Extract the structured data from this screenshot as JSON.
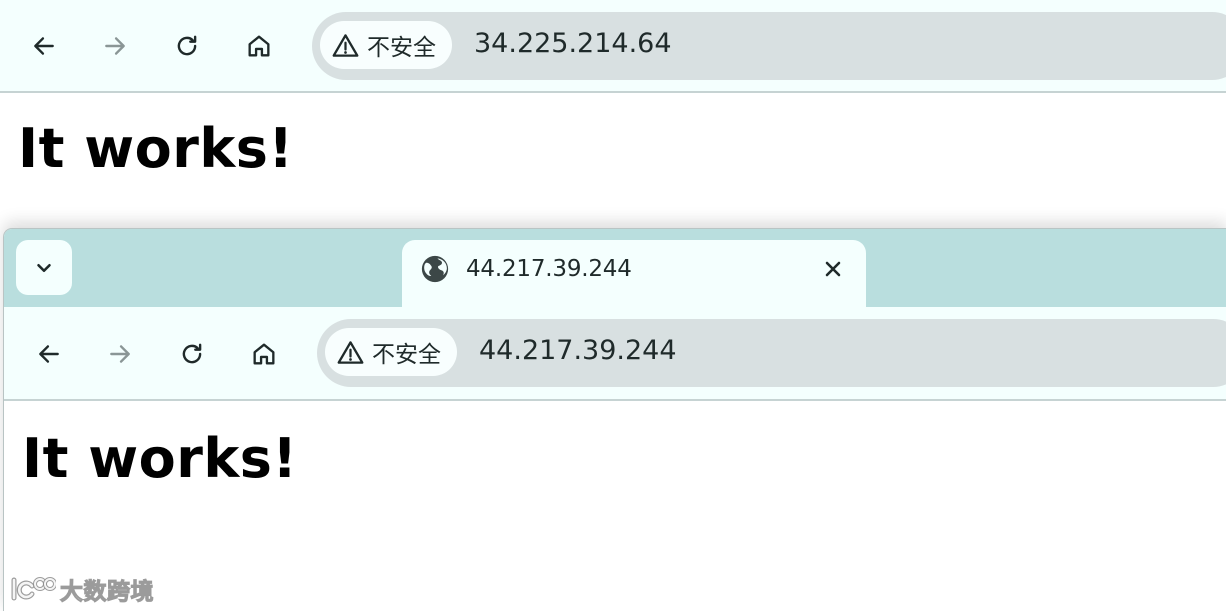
{
  "back_window": {
    "toolbar": {
      "back_icon": "arrow-left-icon",
      "forward_icon": "arrow-right-icon",
      "reload_icon": "reload-icon",
      "home_icon": "home-icon"
    },
    "omnibox": {
      "security_icon": "warning-triangle-icon",
      "security_label": "不安全",
      "url": "34.225.214.64"
    },
    "page": {
      "heading": "It works!"
    }
  },
  "front_window": {
    "tab_strip": {
      "tab_menu_icon": "chevron-down-icon",
      "tab": {
        "favicon": "globe-icon",
        "title": "44.217.39.244",
        "close_icon": "close-icon"
      }
    },
    "toolbar": {
      "back_icon": "arrow-left-icon",
      "forward_icon": "arrow-right-icon",
      "reload_icon": "reload-icon",
      "home_icon": "home-icon"
    },
    "omnibox": {
      "security_icon": "warning-triangle-icon",
      "security_label": "不安全",
      "url": "44.217.39.244"
    },
    "page": {
      "heading": "It works!"
    }
  },
  "watermark": {
    "logo": "watermark-logo",
    "text": "大数跨境"
  },
  "colors": {
    "toolbar_bg": "#f4fffe",
    "tab_strip_bg": "#b9dede",
    "omnibox_bg": "#d8e0e1",
    "security_chip_bg": "#f8fefe",
    "text": "#1f2a2a",
    "disabled_icon": "#8a9696"
  }
}
